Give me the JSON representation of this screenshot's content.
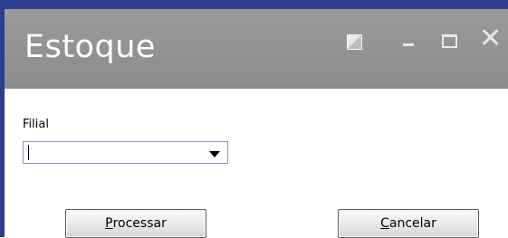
{
  "window": {
    "title": "Estoque",
    "controls": {
      "restore": "restore-icon",
      "minimize": "minimize-icon",
      "maximize": "maximize-icon",
      "close": "close-icon"
    }
  },
  "form": {
    "filial_label": "Filial",
    "filial_value": ""
  },
  "buttons": {
    "processar_accel": "P",
    "processar_rest": "rocessar",
    "cancelar_accel": "C",
    "cancelar_rest": "ancelar"
  },
  "colors": {
    "titlebar": "#929292",
    "outer_frame": "#2c3e8c",
    "title_text": "#ffffff"
  }
}
